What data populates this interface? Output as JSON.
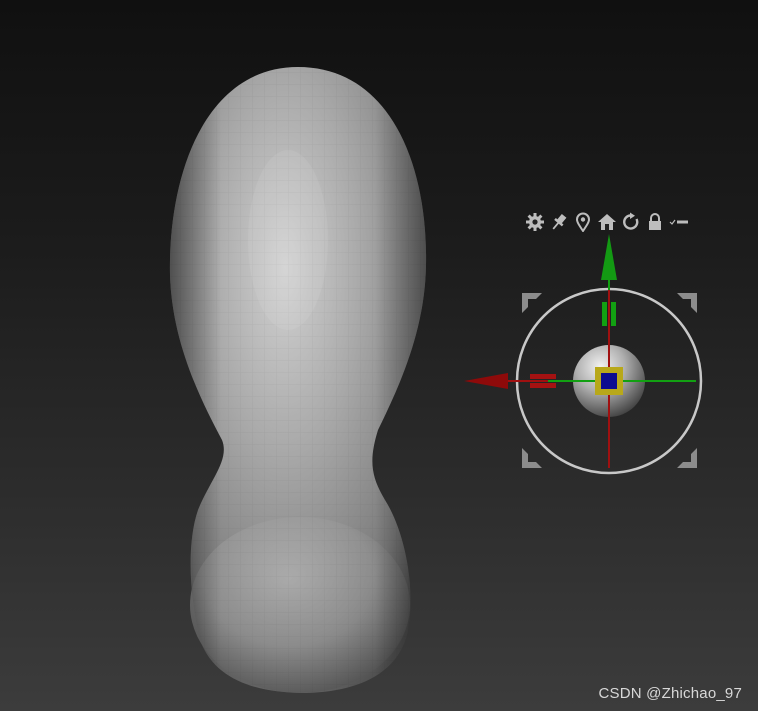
{
  "viewport": {
    "name": "3D viewport",
    "background_top": "#101010",
    "background_bottom": "#3c3c3c"
  },
  "model": {
    "shape": "gourd-shaped sculpt mesh",
    "color": "#9a9a9a"
  },
  "gizmo_toolbar": {
    "tools": [
      {
        "icon": "gear-icon"
      },
      {
        "icon": "pin-icon"
      },
      {
        "icon": "location-pin-icon"
      },
      {
        "icon": "home-icon"
      },
      {
        "icon": "reset-rotate-icon"
      },
      {
        "icon": "lock-icon"
      },
      {
        "icon": "minus-icon"
      }
    ]
  },
  "gizmo": {
    "axis_x_color": "#a01010",
    "axis_y_color": "#10a010",
    "axis_z_color": "#0c0c90",
    "ring_color": "#c8c8c8"
  },
  "watermark": {
    "text": "CSDN @Zhichao_97"
  }
}
